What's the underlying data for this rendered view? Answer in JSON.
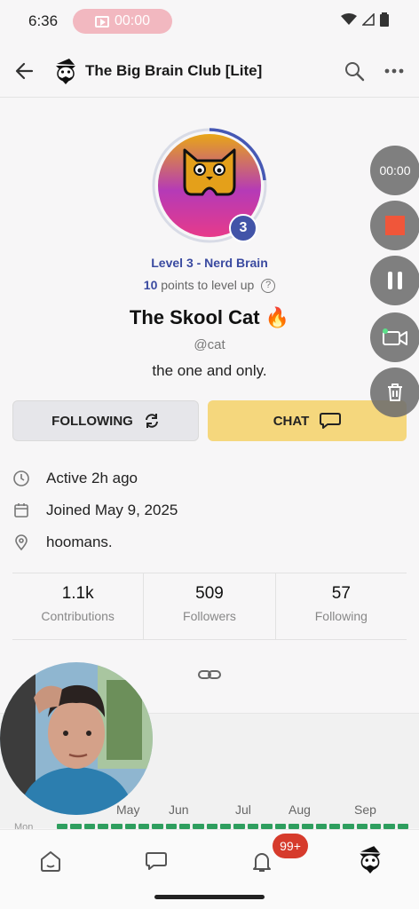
{
  "status_bar": {
    "time": "6:36",
    "recording_time": "00:00"
  },
  "header": {
    "title": "The Big Brain Club [Lite]"
  },
  "profile": {
    "level_badge": "3",
    "level_label": "Level 3 - Nerd Brain",
    "points_number": "10",
    "points_text": " points to level up",
    "name": "The Skool Cat",
    "name_emoji": "🔥",
    "handle": "@cat",
    "bio": "the one and only."
  },
  "actions": {
    "following_label": "FOLLOWING",
    "chat_label": "CHAT"
  },
  "info": {
    "active": "Active 2h ago",
    "joined": "Joined May 9, 2025",
    "location": "hoomans."
  },
  "stats": [
    {
      "value": "1.1k",
      "label": "Contributions"
    },
    {
      "value": "509",
      "label": "Followers"
    },
    {
      "value": "57",
      "label": "Following"
    }
  ],
  "activity": {
    "months": [
      "May",
      "Jun",
      "Jul",
      "Aug",
      "Sep"
    ],
    "row_label": "Mon"
  },
  "recorder": {
    "timer": "00:00"
  },
  "nav": {
    "notifications_badge": "99+"
  },
  "colors": {
    "accent_blue": "#3a4aa0",
    "chat_yellow": "#f5d77d",
    "badge_red": "#d63b2c",
    "heatmap_green": "#2e9e5e",
    "record_red": "#f0563a"
  },
  "icons": [
    "back-arrow-icon",
    "search-icon",
    "more-icon",
    "refresh-icon",
    "chat-bubble-icon",
    "clock-icon",
    "calendar-icon",
    "location-pin-icon",
    "link-icon",
    "home-icon",
    "messages-icon",
    "bell-icon",
    "stop-icon",
    "pause-icon",
    "camera-icon",
    "trash-icon"
  ]
}
